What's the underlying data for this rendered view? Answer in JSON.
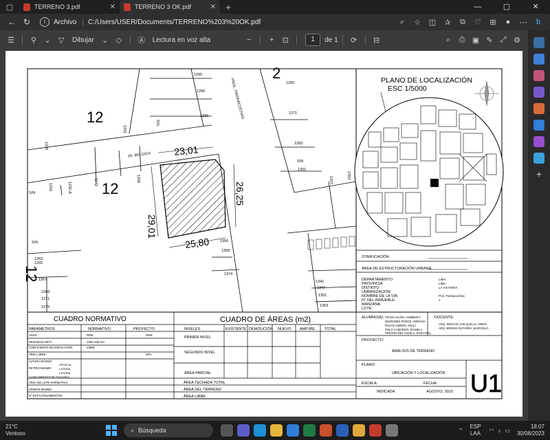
{
  "browser": {
    "tabs": [
      {
        "title": "TERRENO 3.pdf",
        "active": false
      },
      {
        "title": "TERRENO 3 OK.pdf",
        "active": true
      }
    ],
    "address": {
      "scheme_label": "Archivo",
      "url": "C:/Users/USER/Documents/TERRENO%203%20OK.pdf"
    }
  },
  "pdf_toolbar": {
    "draw_label": "Dibujar",
    "read_aloud_label": "Lectura en voz alta",
    "zoom_out": "−",
    "zoom_in": "+",
    "page_current": "1",
    "page_total": "de 1"
  },
  "drawing": {
    "plano_localizacion_title": "PLANO DE LOCALIZACIÓN",
    "plano_localizacion_scale": "ESC 1/5000",
    "street_belgica": "JR. BELGICA",
    "street_parinacochas": "PROL. PARINACOCHAS",
    "dim_top": "23,01",
    "dim_left": "29,01",
    "dim_right": "26,25",
    "dim_bottom": "25,80",
    "lot_numbers": [
      "1250",
      "1266",
      "1290",
      "1265",
      "1271",
      "1283",
      "1291",
      "1229",
      "1251",
      "1216",
      "1232-A",
      "1242",
      "1258",
      "1356",
      "1358",
      "1374",
      "1341",
      "1347",
      "1351",
      "1353",
      "1263",
      "1265",
      "1267",
      "1269",
      "1271",
      "1275",
      "1327",
      "1353"
    ],
    "lot_number_12_a": "12",
    "lot_number_12_b": "12",
    "lot_number_12_c": "12",
    "lot_number_2_a": "2",
    "sn_labels": [
      "S/N",
      "S/N",
      "S/N",
      "S/N"
    ],
    "cuadro_normativo": {
      "title": "CUADRO NORMATIVO",
      "headers": [
        "PARÁMETROS",
        "NORMATIVO",
        "PROYECTO"
      ],
      "rows": [
        [
          "USOS",
          "RDM",
          "RDM"
        ],
        [
          "DENSIDAD NETA",
          "1300 Hab./HA",
          ""
        ],
        [
          "COEFICIENTE DE EDIFICACIÓN",
          "LIBRE",
          ""
        ],
        [
          "ÁREA LIBRE",
          "",
          "30%"
        ],
        [
          "ALTURA MÁXIMA",
          "",
          ""
        ],
        [
          "RETIRO MINIMO",
          "",
          ""
        ],
        [
          "ALINEAMIENTO DE FACHADA",
          "",
          ""
        ],
        [
          "ÁREA DE LOTE NORMATIVO",
          "",
          ""
        ],
        [
          "FRENTE MINIMO",
          "",
          ""
        ],
        [
          "N° ESTACIONAMIENTOS",
          "",
          ""
        ]
      ],
      "retiro_sub": [
        "FRONTAL",
        "LATERAL",
        "LATERAL"
      ]
    },
    "cuadro_areas": {
      "title": "CUADRO DE ÁREAS (m2)",
      "headers": [
        "NIVELES",
        "EXISTENTE",
        "DEMOLICIÓN",
        "NUEVO",
        "AMP./RE",
        "TOTAL"
      ],
      "rows": [
        "PRIMER NIVEL",
        "SEGUNDO NIVEL",
        "ÁREA PARCIAL"
      ],
      "footer_rows": [
        "ÁREA TECHADA TOTAL",
        "ÁREA DEL TERRENO",
        "ÁREA LIBRE"
      ]
    },
    "info": {
      "zonificacion": "ZONIFICACIÓN:",
      "area_estructuracion": "ÁREA DE ESTRUCTURACIÓN URBANA:",
      "labels": [
        "DEPARTAMENTO:",
        "PROVINCIA:",
        "DISTRITO:",
        "URBANIZACIÓN:",
        "NOMBRE DE LA VÍA:",
        "N° DEL INMUEBLE:",
        "MANZANA:",
        "LOTE:"
      ],
      "values": [
        "LIMA",
        "LIMA",
        "LA VICTORIA",
        "",
        "Prol. Parinacochas",
        "1",
        "",
        ""
      ],
      "alumnos_label": "ALUMNO(A):",
      "alumnos": [
        "PICON ACUÑA, KIMBERLY",
        "QUIÑONES PONCE, ADRIANA",
        "ROJAS ASERÍN, ANALÍ",
        "POLO CAMARGO, DANIELA",
        "VERANO DEL ÁGUILA, KHRYSTAL"
      ],
      "docente_label": "DOCENTE:",
      "docentes": [
        "ARQ.      WINCHO CHILQUILLO, OMAR",
        "ARQ.      BRENIS GUTARRA, MARCIELO"
      ],
      "proyecto_label": "PROYECTO:",
      "proyecto": "ANÁLISIS DE TERRENO",
      "plano_label": "PLANO:",
      "plano": "UBICACIÓN Y LOCALIZACIÓN",
      "escala_label": "ESCALA:",
      "escala": "INDICADA",
      "fecha_label": "FECHA:",
      "fecha": "AGOSTO, 2023",
      "sheet": "U1"
    }
  },
  "taskbar": {
    "temp": "21°C",
    "weather": "Ventoso",
    "search": "Búsqueda",
    "lang_a": "ESP",
    "lang_b": "LAA",
    "time": "18:07",
    "date": "30/08/2023"
  },
  "colors": {
    "tab_bg": "#202020",
    "toolbar_bg": "#3b3b3b",
    "paper": "#ffffff",
    "accent": "#4fb3ff"
  }
}
